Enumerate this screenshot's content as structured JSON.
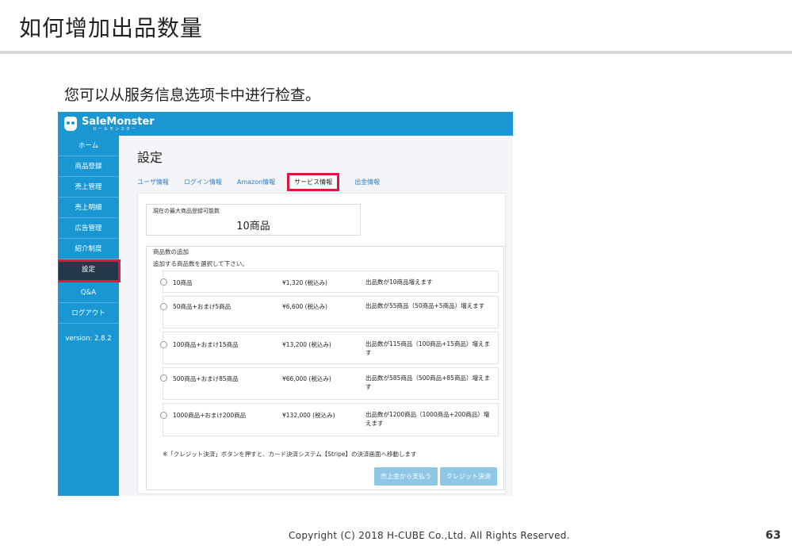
{
  "slide": {
    "title": "如何增加出品数量",
    "intro": "您可以从服务信息选项卡中进行检查。",
    "footer": "Copyright (C) 2018 H-CUBE Co.,Ltd. All Rights Reserved.",
    "page_number": "63"
  },
  "app": {
    "logo_main": "SaleMonster",
    "logo_sub": "セールモンスター",
    "brand_color": "#1a97d2",
    "highlight_color": "#e0173d",
    "sidebar": [
      {
        "label": "ホーム"
      },
      {
        "label": "商品登録"
      },
      {
        "label": "売上管理"
      },
      {
        "label": "売上明細"
      },
      {
        "label": "広告管理"
      },
      {
        "label": "紹介制度"
      },
      {
        "label": "設定"
      },
      {
        "label": "Q&A"
      },
      {
        "label": "ログアウト"
      }
    ],
    "version": "version: 2.8.2",
    "page_heading": "設定",
    "tabs": [
      {
        "label": "ユーザ情報"
      },
      {
        "label": "ログイン情報"
      },
      {
        "label": "Amazon情報"
      },
      {
        "label": "サービス情報"
      },
      {
        "label": "出金情報"
      }
    ],
    "limit_label": "現在の最大商品登録可能数",
    "limit_value": "10商品",
    "add_title": "商品数の追加",
    "add_instruction": "追加する商品数を選択して下さい。",
    "options": [
      {
        "name": "10商品",
        "price": "¥1,320 (税込み)",
        "desc": "出品数が10商品増えます"
      },
      {
        "name": "50商品+おまけ5商品",
        "price": "¥6,600 (税込み)",
        "desc": "出品数が55商品（50商品+5商品）増えます"
      },
      {
        "name": "100商品+おまけ15商品",
        "price": "¥13,200 (税込み)",
        "desc": "出品数が115商品（100商品+15商品）増えます"
      },
      {
        "name": "500商品+おまけ85商品",
        "price": "¥66,000 (税込み)",
        "desc": "出品数が585商品（500商品+85商品）増えます"
      },
      {
        "name": "1000商品+おまけ200商品",
        "price": "¥132,000 (税込み)",
        "desc": "出品数が1200商品（1000商品+200商品）増えます"
      }
    ],
    "notice": "※「クレジット決済」ボタンを押すと、カード決済システム【Stripe】の決済画面へ移動します",
    "pay_sales_button": "売上金から支払う",
    "credit_button": "クレジット決済"
  }
}
